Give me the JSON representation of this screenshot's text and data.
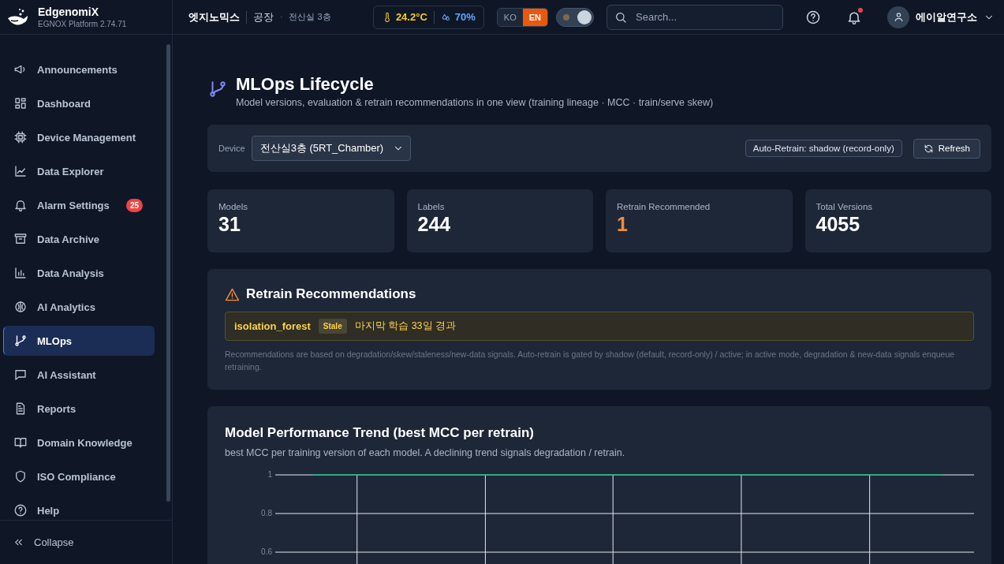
{
  "brand": {
    "name": "EdgenomiX",
    "version": "EGNOX Platform 2.74.71"
  },
  "breadcrumb": {
    "company": "엣지노믹스",
    "site": "공장",
    "separator": "·",
    "room": "전산실 3층"
  },
  "weather": {
    "temperature": "24.2°C",
    "humidity": "70%"
  },
  "languages": [
    {
      "label": "KO",
      "selected": false
    },
    {
      "label": "EN",
      "selected": true
    }
  ],
  "theme_toggle": {
    "on": true
  },
  "search": {
    "placeholder": "Search..."
  },
  "notifications": {
    "unread": true
  },
  "user": {
    "name": "에이알연구소"
  },
  "sidebar": {
    "items": [
      {
        "label": "Announcements",
        "selected": false
      },
      {
        "label": "Dashboard",
        "selected": false
      },
      {
        "label": "Device Management",
        "selected": false
      },
      {
        "label": "Data Explorer",
        "selected": false
      },
      {
        "label": "Alarm Settings",
        "selected": false,
        "badge": "25"
      },
      {
        "label": "Data Archive",
        "selected": false
      },
      {
        "label": "Data Analysis",
        "selected": false
      },
      {
        "label": "AI Analytics",
        "selected": false
      },
      {
        "label": "MLOps",
        "selected": true
      },
      {
        "label": "AI Assistant",
        "selected": false
      },
      {
        "label": "Reports",
        "selected": false
      },
      {
        "label": "Domain Knowledge",
        "selected": false
      },
      {
        "label": "ISO Compliance",
        "selected": false
      },
      {
        "label": "Help",
        "selected": false
      }
    ],
    "collapse": "Collapse"
  },
  "page": {
    "title": "MLOps Lifecycle",
    "subtitle": "Model versions, evaluation & retrain recommendations in one view (training lineage · MCC · train/serve skew)"
  },
  "toolbar": {
    "device_label": "Device",
    "device": "전산실3층 (5RT_Chamber)",
    "auto_retrain": "Auto-Retrain: shadow (record-only)",
    "refresh": "Refresh"
  },
  "stats": [
    {
      "label": "Models",
      "value": "31",
      "alert": false
    },
    {
      "label": "Labels",
      "value": "244",
      "alert": false
    },
    {
      "label": "Retrain Recommended",
      "value": "1",
      "alert": true
    },
    {
      "label": "Total Versions",
      "value": "4055",
      "alert": false
    }
  ],
  "recommendations": {
    "title": "Retrain Recommendations",
    "items": [
      {
        "model": "isolation_forest",
        "tag": "Stale",
        "message": "마지막 학습 33일 경과"
      }
    ],
    "note": "Recommendations are based on degradation/skew/staleness/new-data signals. Auto-retrain is gated by shadow (default, record-only) / active; in active mode, degradation & new-data signals enqueue retraining."
  },
  "trend": {
    "title": "Model Performance Trend (best MCC per retrain)",
    "subtitle": "best MCC per training version of each model. A declining trend signals degradation / retrain.",
    "chart_data": {
      "type": "line",
      "categories": [
        null,
        null,
        null,
        null,
        null,
        null,
        null,
        null,
        null,
        null,
        null,
        null,
        null,
        null,
        null,
        null,
        null,
        null
      ],
      "grid": true,
      "ylim": [
        0,
        1
      ],
      "yticks": [
        {
          "value": 0.6,
          "label": "0.6"
        },
        {
          "value": 0.8,
          "label": "0.8"
        },
        {
          "value": 1,
          "label": "1"
        }
      ],
      "series": [
        {
          "color": "#10b981",
          "values": [
            1,
            1,
            1,
            1,
            1,
            1,
            1,
            1,
            1,
            1,
            1,
            1,
            1,
            1,
            1,
            1,
            1,
            1
          ]
        }
      ]
    }
  }
}
